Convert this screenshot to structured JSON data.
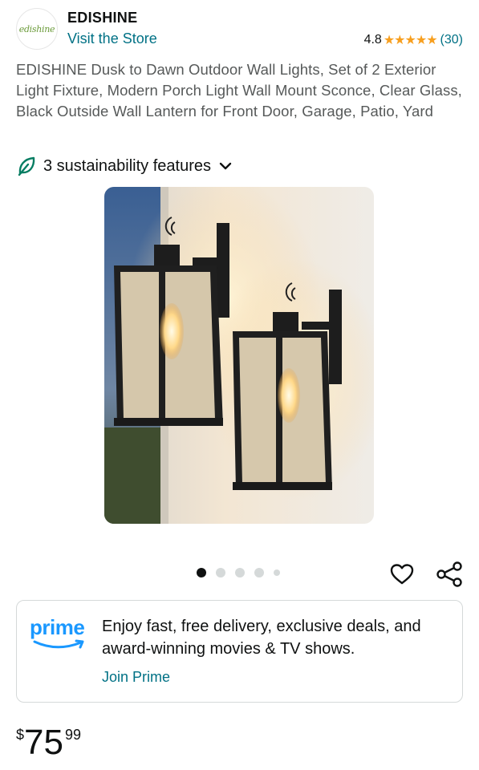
{
  "store": {
    "logo_text": "edishine",
    "brand_name": "EDISHINE",
    "visit_label": "Visit the Store",
    "rating_value": "4.8",
    "stars_glyphs": "★★★★★",
    "rating_stars": 4.8,
    "rating_count": "(30)"
  },
  "product": {
    "title": "EDISHINE Dusk to Dawn Outdoor Wall Lights, Set of 2 Exterior Light Fixture, Modern Porch Light Wall Mount Sconce, Clear Glass, Black Outside Wall Lantern for Front Door, Garage, Patio, Yard"
  },
  "sustainability": {
    "label": "3 sustainability features",
    "icon": "leaf-icon",
    "accent_color": "#067d62"
  },
  "gallery": {
    "image_count": 5,
    "active_index": 0
  },
  "actions": {
    "favorite_icon": "heart-icon",
    "share_icon": "share-icon"
  },
  "prime": {
    "logo_word": "prime",
    "message": "Enjoy fast, free delivery, exclusive deals, and award-winning movies & TV shows.",
    "cta": "Join Prime",
    "brand_color": "#1a98ff"
  },
  "price": {
    "symbol": "$",
    "whole": "75",
    "fraction": "99"
  },
  "colors": {
    "link": "#007185",
    "star": "#f79f1f",
    "text": "#0f1111",
    "muted": "#565959"
  }
}
